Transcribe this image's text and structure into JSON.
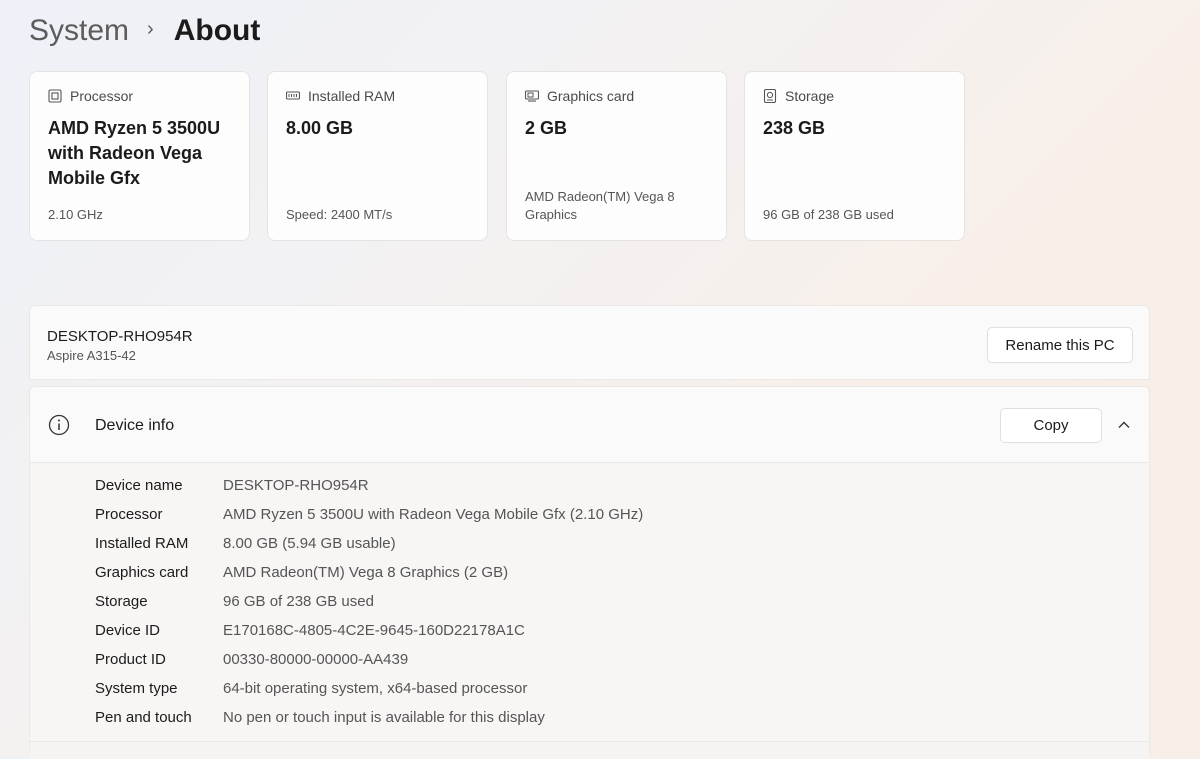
{
  "breadcrumb": {
    "parent": "System",
    "separator": "›",
    "current": "About"
  },
  "cards": [
    {
      "icon": "processor-icon",
      "label": "Processor",
      "value": "AMD Ryzen 5 3500U with Radeon Vega Mobile Gfx",
      "sub": "2.10 GHz"
    },
    {
      "icon": "ram-icon",
      "label": "Installed RAM",
      "value": "8.00 GB",
      "sub": "Speed: 2400 MT/s"
    },
    {
      "icon": "graphics-card-icon",
      "label": "Graphics card",
      "value": "2 GB",
      "sub": "AMD Radeon(TM) Vega 8 Graphics"
    },
    {
      "icon": "storage-icon",
      "label": "Storage",
      "value": "238 GB",
      "sub": "96 GB of 238 GB used"
    }
  ],
  "pc": {
    "name": "DESKTOP-RHO954R",
    "model": "Aspire A315-42",
    "rename_label": "Rename this PC"
  },
  "device_info": {
    "icon": "info-icon",
    "title": "Device info",
    "copy_label": "Copy",
    "rows": [
      {
        "label": "Device name",
        "value": "DESKTOP-RHO954R"
      },
      {
        "label": "Processor",
        "value": "AMD Ryzen 5 3500U with Radeon Vega Mobile Gfx (2.10 GHz)"
      },
      {
        "label": "Installed RAM",
        "value": "8.00 GB (5.94 GB usable)"
      },
      {
        "label": "Graphics card",
        "value": "AMD Radeon(TM) Vega 8 Graphics (2 GB)"
      },
      {
        "label": "Storage",
        "value": "96 GB of 238 GB used"
      },
      {
        "label": "Device ID",
        "value": "E170168C-4805-4C2E-9645-160D22178A1C"
      },
      {
        "label": "Product ID",
        "value": "00330-80000-00000-AA439"
      },
      {
        "label": "System type",
        "value": "64-bit operating system, x64-based processor"
      },
      {
        "label": "Pen and touch",
        "value": "No pen or touch input is available for this display"
      }
    ]
  }
}
